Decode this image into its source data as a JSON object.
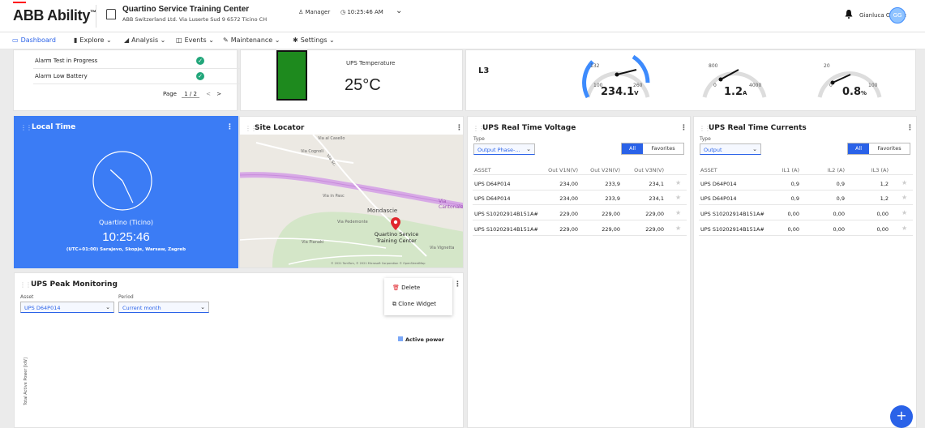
{
  "header": {
    "brand": "ABB Ability",
    "brand_tm": "™",
    "site_name": "Quartino Service Training Center",
    "site_address": "ABB Switzerland Ltd. Via Luserte Sud 9 6572 Ticino CH",
    "role": "Manager",
    "time": "10:25:46 AM",
    "user_name": "Gianluca Gentile",
    "avatar_initials": "GG"
  },
  "nav": {
    "items": [
      {
        "label": "Dashboard",
        "icon": "dashboard-icon"
      },
      {
        "label": "Explore",
        "icon": "explore-icon"
      },
      {
        "label": "Analysis",
        "icon": "analysis-icon"
      },
      {
        "label": "Events",
        "icon": "events-icon"
      },
      {
        "label": "Maintenance",
        "icon": "wrench-icon"
      },
      {
        "label": "Settings",
        "icon": "gear-icon"
      }
    ]
  },
  "alarms": {
    "rows": [
      {
        "label": "Alarm Test in Progress",
        "status": "ok"
      },
      {
        "label": "Alarm Low Battery",
        "status": "ok"
      }
    ],
    "page_label": "Page",
    "page": "1 / 2"
  },
  "temperature": {
    "label": "UPS Temperature",
    "value": "25°C"
  },
  "gauges": {
    "phase_label": "L3",
    "voltage": {
      "min": "100",
      "max": "260",
      "mid": "132",
      "value": "234.1",
      "unit": "V"
    },
    "current": {
      "min": "0",
      "max": "4000",
      "mid": "800",
      "value": "1.2",
      "unit": "A"
    },
    "power": {
      "min": "0",
      "max": "100",
      "mid": "20",
      "value": "0.8",
      "unit": "%"
    }
  },
  "local_time": {
    "title": "Local Time",
    "city": "Quartino (Ticino)",
    "time": "10:25:46",
    "tz": "(UTC+01:00) Sarajevo, Skopje, Warsaw, Zagreb",
    "hour": 10,
    "minute": 25,
    "second": 46
  },
  "site_locator": {
    "title": "Site Locator",
    "place": "Mondascie",
    "marker_label_1": "Quartino Service",
    "marker_label_2": "Training Center",
    "roads": [
      "Via al Casello",
      "Via Cognoli",
      "Via in Pasc",
      "Via Cantonale",
      "Via Pedemonte",
      "Via Pianaki",
      "Via Vignetta",
      "Via Sc."
    ],
    "copyright": "© 2021 TomTom, © 2021 Microsoft Corporation © OpenStreetMap"
  },
  "voltage": {
    "title": "UPS Real Time Voltage",
    "type_label": "Type",
    "type_value": "Output Phase-...",
    "seg_all": "All",
    "seg_fav": "Favorites",
    "columns": [
      "ASSET",
      "Out V1N(V)",
      "Out V2N(V)",
      "Out V3N(V)"
    ],
    "rows": [
      [
        "UPS D64P014",
        "234,00",
        "233,9",
        "234,1"
      ],
      [
        "UPS D64P014",
        "234,00",
        "233,9",
        "234,1"
      ],
      [
        "UPS S10202914B151A#",
        "229,00",
        "229,00",
        "229,00"
      ],
      [
        "UPS S10202914B151A#",
        "229,00",
        "229,00",
        "229,00"
      ]
    ]
  },
  "currents": {
    "title": "UPS Real Time Currents",
    "type_label": "Type",
    "type_value": "Output",
    "seg_all": "All",
    "seg_fav": "Favorites",
    "columns": [
      "ASSET",
      "IL1 (A)",
      "IL2 (A)",
      "IL3 (A)"
    ],
    "rows": [
      [
        "UPS D64P014",
        "0,9",
        "0,9",
        "1,2"
      ],
      [
        "UPS D64P014",
        "0,9",
        "0,9",
        "1,2"
      ],
      [
        "UPS S10202914B151A#",
        "0,00",
        "0,00",
        "0,00"
      ],
      [
        "UPS S10202914B151A#",
        "0,00",
        "0,00",
        "0,00"
      ]
    ]
  },
  "peak": {
    "title": "UPS Peak Monitoring",
    "asset_label": "Asset",
    "asset_value": "UPS D64P014",
    "period_label": "Period",
    "period_value": "Current month",
    "legend": "Active power",
    "ylabel": "Total Active Power [kW]"
  },
  "context_menu": {
    "delete": "Delete",
    "clone": "Clone Widget"
  },
  "fab": "+",
  "colors": {
    "accent": "#2a62e8",
    "brand_red": "#ff000f",
    "ok_green": "#21a67a",
    "temp_green": "#1e8a1e"
  }
}
